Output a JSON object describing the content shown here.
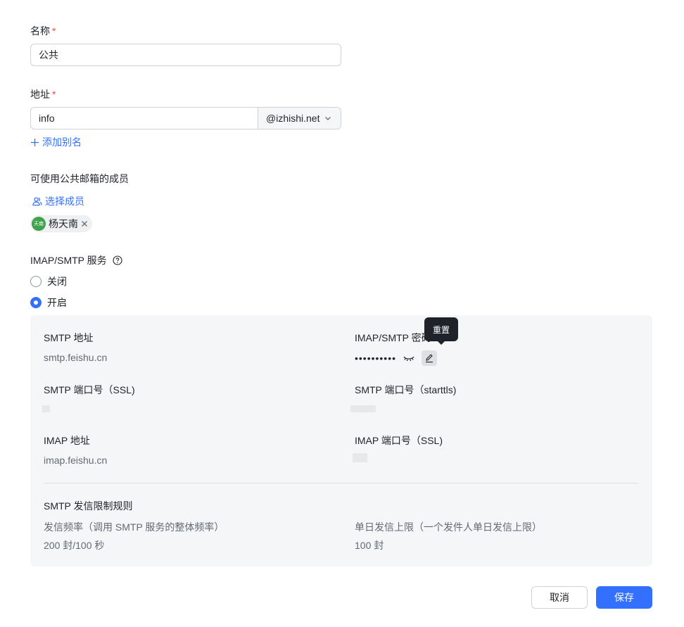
{
  "form": {
    "name_label": "名称",
    "required_mark": "*",
    "name_value": "公共",
    "address_label": "地址",
    "address_value": "info",
    "domain_value": "@izhishi.net",
    "add_alias_label": "添加别名",
    "members_label": "可使用公共邮箱的成员",
    "select_members_label": "选择成员",
    "member": {
      "avatar_text": "天南",
      "name": "杨天南"
    },
    "service_label": "IMAP/SMTP 服务",
    "radio_off_label": "关闭",
    "radio_on_label": "开启",
    "service_enabled": true
  },
  "panel": {
    "smtp_address_label": "SMTP 地址",
    "smtp_address_value": "smtp.feishu.cn",
    "password_label": "IMAP/SMTP 密码",
    "password_value": "••••••••••",
    "reset_tooltip": "重置",
    "smtp_ssl_port_label": "SMTP 端口号（SSL)",
    "smtp_starttls_port_label": "SMTP 端口号（starttls)",
    "imap_address_label": "IMAP 地址",
    "imap_address_value": "imap.feishu.cn",
    "imap_ssl_port_label": "IMAP 端口号（SSL)",
    "rules_title": "SMTP 发信限制规则",
    "rate_label": "发信频率（调用 SMTP 服务的整体频率）",
    "rate_value": "200 封/100 秒",
    "daily_label": "单日发信上限（一个发件人单日发信上限）",
    "daily_value": "100 封"
  },
  "footer": {
    "cancel_label": "取消",
    "save_label": "保存"
  },
  "colors": {
    "primary": "#3370ff",
    "required": "#f54a45",
    "panel_bg": "#f5f6f7",
    "avatar_bg": "#3ea34a"
  },
  "icons": [
    "plus-icon",
    "user-group-icon",
    "close-icon",
    "help-icon",
    "chevron-down-icon",
    "eye-closed-icon",
    "edit-icon"
  ]
}
